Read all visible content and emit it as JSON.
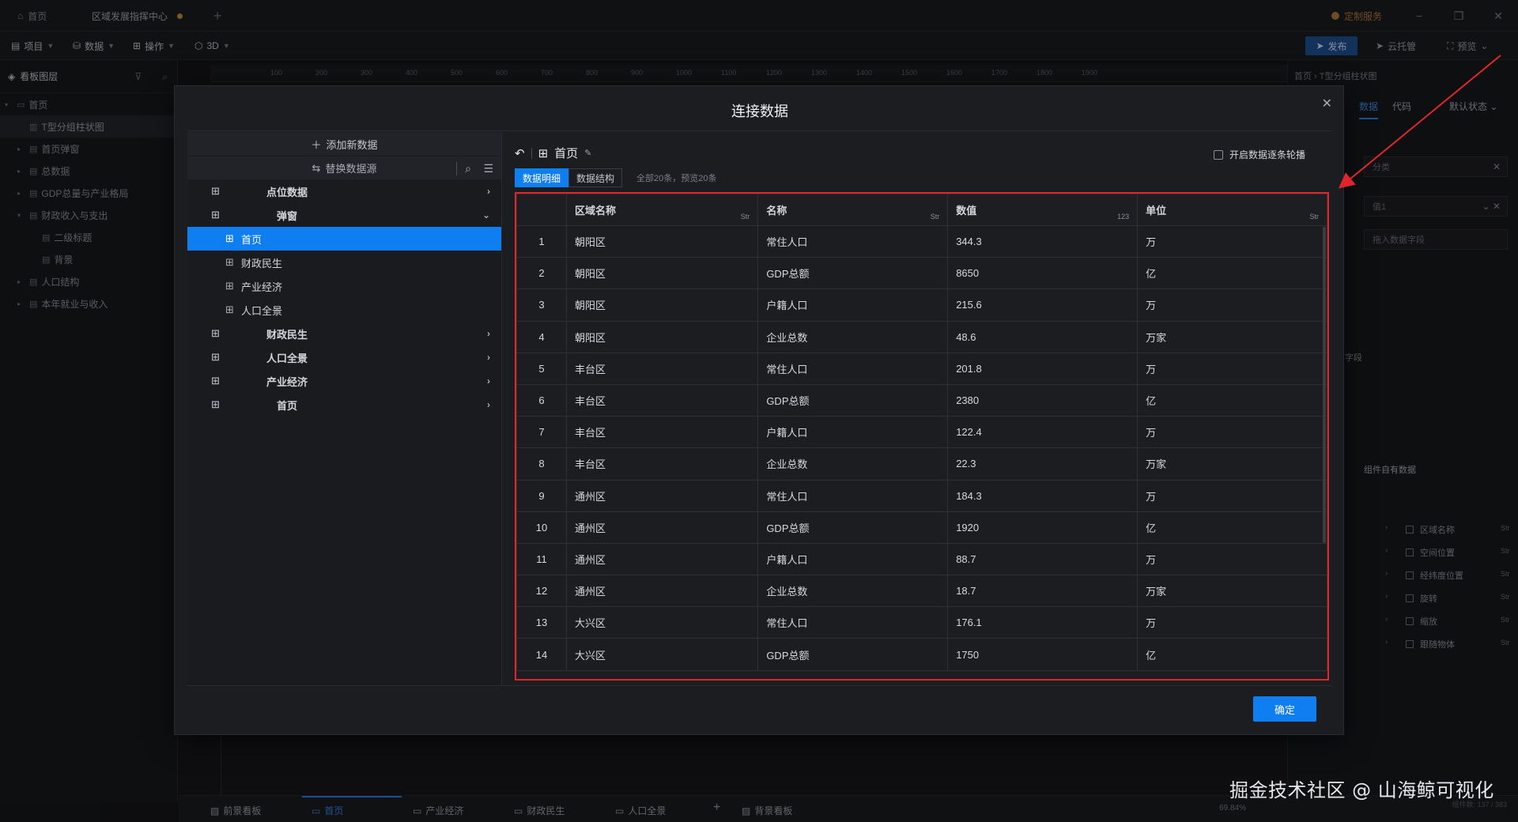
{
  "titlebar": {
    "home_tab": "首页",
    "doc_tab": "区域发展指挥中心",
    "plus": "+",
    "custom_service": "定制服务",
    "minimize": "−",
    "restore": "❐",
    "close": "✕"
  },
  "toolbar": {
    "menus": [
      "项目",
      "数据",
      "操作",
      "3D"
    ],
    "publish": "发布",
    "cloud": "云托管",
    "preview": "预览"
  },
  "left_panel": {
    "title": "看板图层",
    "layers": [
      {
        "label": "首页",
        "level": 0,
        "arrow": "▾"
      },
      {
        "label": "T型分组柱状图",
        "level": 1,
        "arrow": ""
      },
      {
        "label": "首页弹窗",
        "level": 1,
        "arrow": "▸"
      },
      {
        "label": "总数据",
        "level": 1,
        "arrow": "▸"
      },
      {
        "label": "GDP总量与产业格局",
        "level": 1,
        "arrow": "▸"
      },
      {
        "label": "财政收入与支出",
        "level": 1,
        "arrow": "▾"
      },
      {
        "label": "二级标题",
        "level": 2,
        "arrow": ""
      },
      {
        "label": "背景",
        "level": 2,
        "arrow": ""
      },
      {
        "label": "人口结构",
        "level": 1,
        "arrow": "▸"
      },
      {
        "label": "本年就业与收入",
        "level": 1,
        "arrow": "▸"
      }
    ]
  },
  "ruler": [
    "100",
    "200",
    "300",
    "400",
    "500",
    "600",
    "700",
    "800",
    "900",
    "1000",
    "1100",
    "1200",
    "1300",
    "1400",
    "1500",
    "1600",
    "1700",
    "1800",
    "1900"
  ],
  "right_panel": {
    "breadcrumb": "首页 › T型分组柱状图",
    "tabs": [
      "数据",
      "代码"
    ],
    "state": "默认状态",
    "input_category": "分类",
    "input_value": "值1",
    "drag_hint": "拖入数据字段",
    "field_label": "字段",
    "own_data": "组件自有数据",
    "fields": [
      "区域名称",
      "空间位置",
      "经纬度位置",
      "旋转",
      "缩放",
      "跟随物体"
    ],
    "field_type": "Str"
  },
  "modal": {
    "title": "连接数据",
    "add_source": "添加新数据",
    "replace_source": "替换数据源",
    "sources": [
      {
        "label": "点位数据",
        "type": "group",
        "chev": "›"
      },
      {
        "label": "弹窗",
        "type": "group",
        "chev": "⌄"
      },
      {
        "label": "首页",
        "type": "child-active",
        "chev": ""
      },
      {
        "label": "财政民生",
        "type": "child",
        "chev": ""
      },
      {
        "label": "产业经济",
        "type": "child",
        "chev": ""
      },
      {
        "label": "人口全景",
        "type": "child",
        "chev": ""
      },
      {
        "label": "财政民生",
        "type": "group",
        "chev": "›"
      },
      {
        "label": "人口全景",
        "type": "group",
        "chev": "›"
      },
      {
        "label": "产业经济",
        "type": "group",
        "chev": "›"
      },
      {
        "label": "首页",
        "type": "group",
        "chev": "›"
      }
    ],
    "detail_title": "首页",
    "carousel_label": "开启数据逐条轮播",
    "tab_detail": "数据明细",
    "tab_structure": "数据结构",
    "count_text": "全部20条，预览20条",
    "columns": [
      {
        "name": "区域名称",
        "type": "Str"
      },
      {
        "name": "名称",
        "type": "Str"
      },
      {
        "name": "数值",
        "type": "123"
      },
      {
        "name": "单位",
        "type": "Str"
      }
    ],
    "rows": [
      [
        "1",
        "朝阳区",
        "常住人口",
        "344.3",
        "万"
      ],
      [
        "2",
        "朝阳区",
        "GDP总额",
        "8650",
        "亿"
      ],
      [
        "3",
        "朝阳区",
        "户籍人口",
        "215.6",
        "万"
      ],
      [
        "4",
        "朝阳区",
        "企业总数",
        "48.6",
        "万家"
      ],
      [
        "5",
        "丰台区",
        "常住人口",
        "201.8",
        "万"
      ],
      [
        "6",
        "丰台区",
        "GDP总额",
        "2380",
        "亿"
      ],
      [
        "7",
        "丰台区",
        "户籍人口",
        "122.4",
        "万"
      ],
      [
        "8",
        "丰台区",
        "企业总数",
        "22.3",
        "万家"
      ],
      [
        "9",
        "通州区",
        "常住人口",
        "184.3",
        "万"
      ],
      [
        "10",
        "通州区",
        "GDP总额",
        "1920",
        "亿"
      ],
      [
        "11",
        "通州区",
        "户籍人口",
        "88.7",
        "万"
      ],
      [
        "12",
        "通州区",
        "企业总数",
        "18.7",
        "万家"
      ],
      [
        "13",
        "大兴区",
        "常住人口",
        "176.1",
        "万"
      ],
      [
        "14",
        "大兴区",
        "GDP总额",
        "1750",
        "亿"
      ]
    ],
    "confirm": "确定"
  },
  "bottombar": {
    "tabs": [
      "前景看板",
      "首页",
      "产业经济",
      "财政民生",
      "人口全景",
      "+",
      "背景看板"
    ],
    "zoom": "69.84%",
    "component_count": "组件数: 137 / 383"
  },
  "watermark": "掘金技术社区 @ 山海鲸可视化",
  "colors": {
    "accent": "#0f7ef0",
    "highlight_border": "#e0262b",
    "bg": "#151619"
  }
}
